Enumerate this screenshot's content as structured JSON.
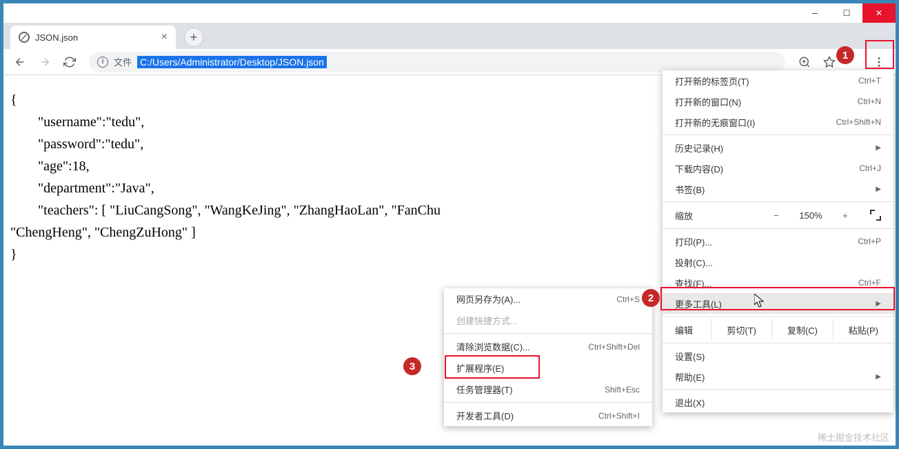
{
  "window": {
    "tab_title": "JSON.json",
    "url_label": "文件",
    "url": "C:/Users/Administrator/Desktop/JSON.json"
  },
  "content_text": "{\n        \"username\":\"tedu\",\n        \"password\":\"tedu\",\n        \"age\":18,\n        \"department\":\"Java\",\n        \"teachers\": [ \"LiuCangSong\", \"WangKeJing\", \"ZhangHaoLan\", \"FanChu\n\"ChengHeng\", \"ChengZuHong\" ]\n}",
  "menu": {
    "new_tab": "打开新的标签页(T)",
    "new_tab_sc": "Ctrl+T",
    "new_window": "打开新的窗口(N)",
    "new_window_sc": "Ctrl+N",
    "incognito": "打开新的无痕窗口(I)",
    "incognito_sc": "Ctrl+Shift+N",
    "history": "历史记录(H)",
    "downloads": "下载内容(D)",
    "downloads_sc": "Ctrl+J",
    "bookmarks": "书签(B)",
    "zoom": "缩放",
    "zoom_val": "150%",
    "print": "打印(P)...",
    "print_sc": "Ctrl+P",
    "cast": "投射(C)...",
    "find": "查找(F)...",
    "find_sc": "Ctrl+F",
    "more_tools": "更多工具(L)",
    "edit": "编辑",
    "cut": "剪切(T)",
    "copy": "复制(C)",
    "paste": "粘贴(P)",
    "settings": "设置(S)",
    "help": "帮助(E)",
    "exit": "退出(X)"
  },
  "submenu": {
    "save_as": "网页另存为(A)...",
    "save_as_sc": "Ctrl+S",
    "create_shortcut": "创建快捷方式...",
    "clear_data": "清除浏览数据(C)...",
    "clear_data_sc": "Ctrl+Shift+Del",
    "extensions": "扩展程序(E)",
    "task_manager": "任务管理器(T)",
    "task_manager_sc": "Shift+Esc",
    "dev_tools": "开发者工具(D)",
    "dev_tools_sc": "Ctrl+Shift+I"
  },
  "badges": {
    "b1": "1",
    "b2": "2",
    "b3": "3"
  },
  "watermark": "稀土掘金技术社区"
}
